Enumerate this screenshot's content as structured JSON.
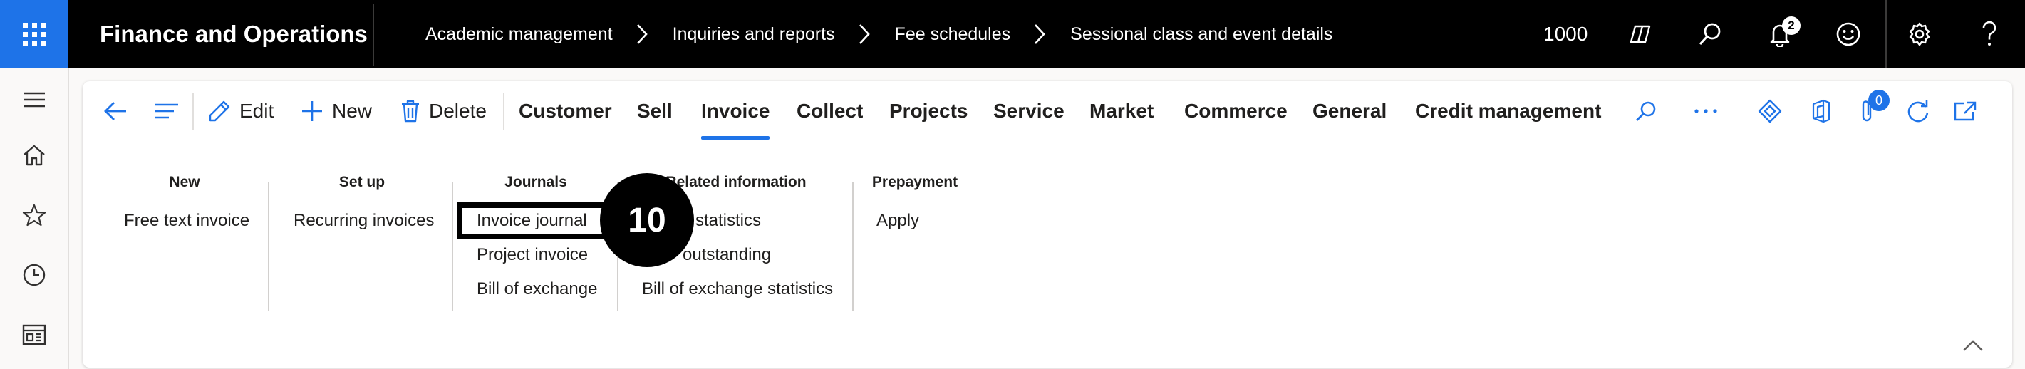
{
  "topbar": {
    "app_title": "Finance and Operations",
    "breadcrumb": [
      "Academic management",
      "Inquiries and reports",
      "Fee schedules",
      "Sessional class and event details"
    ],
    "company": "1000",
    "notification_count": "2",
    "icons": [
      "waffle-icon",
      "copilot-icon",
      "search-icon",
      "bell-icon",
      "smiley-icon",
      "gear-icon",
      "help-icon"
    ]
  },
  "leftnav": {
    "icons": [
      "hamburger-icon",
      "home-icon",
      "star-icon",
      "clock-icon",
      "workspace-icon"
    ]
  },
  "actionbar": {
    "edit_label": "Edit",
    "new_label": "New",
    "delete_label": "Delete",
    "tabs": [
      "Customer",
      "Sell",
      "Invoice",
      "Collect",
      "Projects",
      "Service",
      "Market",
      "Commerce",
      "General",
      "Credit management"
    ],
    "active_tab": "Invoice",
    "attachment_count": "0"
  },
  "ribbon": {
    "groups": [
      {
        "title": "New",
        "buttons": [
          "Free text invoice"
        ]
      },
      {
        "title": "Set up",
        "buttons": [
          "Recurring invoices"
        ]
      },
      {
        "title": "Journals",
        "buttons": [
          "Invoice journal",
          "Project invoice",
          "Bill of exchange"
        ]
      },
      {
        "title": "Related information",
        "buttons": [
          "statistics",
          "outstanding",
          "Bill of exchange statistics"
        ]
      },
      {
        "title": "Prepayment",
        "buttons": [
          "Apply"
        ]
      }
    ]
  },
  "callout": {
    "step": "10"
  },
  "colors": {
    "accent": "#1e73e8",
    "topbar": "#000000"
  }
}
